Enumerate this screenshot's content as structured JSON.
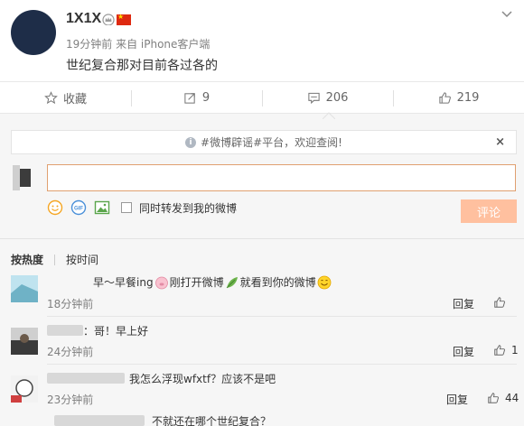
{
  "post": {
    "username": "1X1X",
    "meta": "19分钟前 来自 iPhone客户端",
    "text": "世纪复合那对目前各过各的"
  },
  "actions": {
    "favorite": "收藏",
    "repost": "9",
    "comment": "206",
    "like": "219"
  },
  "notice": {
    "text": "#微博辟谣#平台，欢迎查阅!"
  },
  "composer": {
    "value": "",
    "also_repost": "同时转发到我的微博",
    "submit": "评论"
  },
  "sort": {
    "hot": "按热度",
    "time": "按时间"
  },
  "comments": [
    {
      "text_a": "早～早餐ing",
      "text_b": "刚打开微博",
      "text_c": "就看到你的微博",
      "time": "18分钟前",
      "reply": "回复",
      "likes": ""
    },
    {
      "text": "：哥！早上好",
      "time": "24分钟前",
      "reply": "回复",
      "likes": "1"
    },
    {
      "text": "我怎么浮现wfxtf？应该不是吧",
      "time": "23分钟前",
      "reply": "回复",
      "likes": "44"
    },
    {
      "text": "不就还在哪个世纪复合？",
      "time": "",
      "reply": "",
      "likes": ""
    }
  ],
  "icons": {
    "post_chevron": "chevron-down-icon",
    "favorite": "star-icon",
    "repost": "repost-icon",
    "comment": "comment-icon",
    "like": "thumb-up-icon"
  },
  "colors": {
    "accent": "#ff8140",
    "submit_disabled": "#ffc09f",
    "input_border": "#e0a070"
  }
}
